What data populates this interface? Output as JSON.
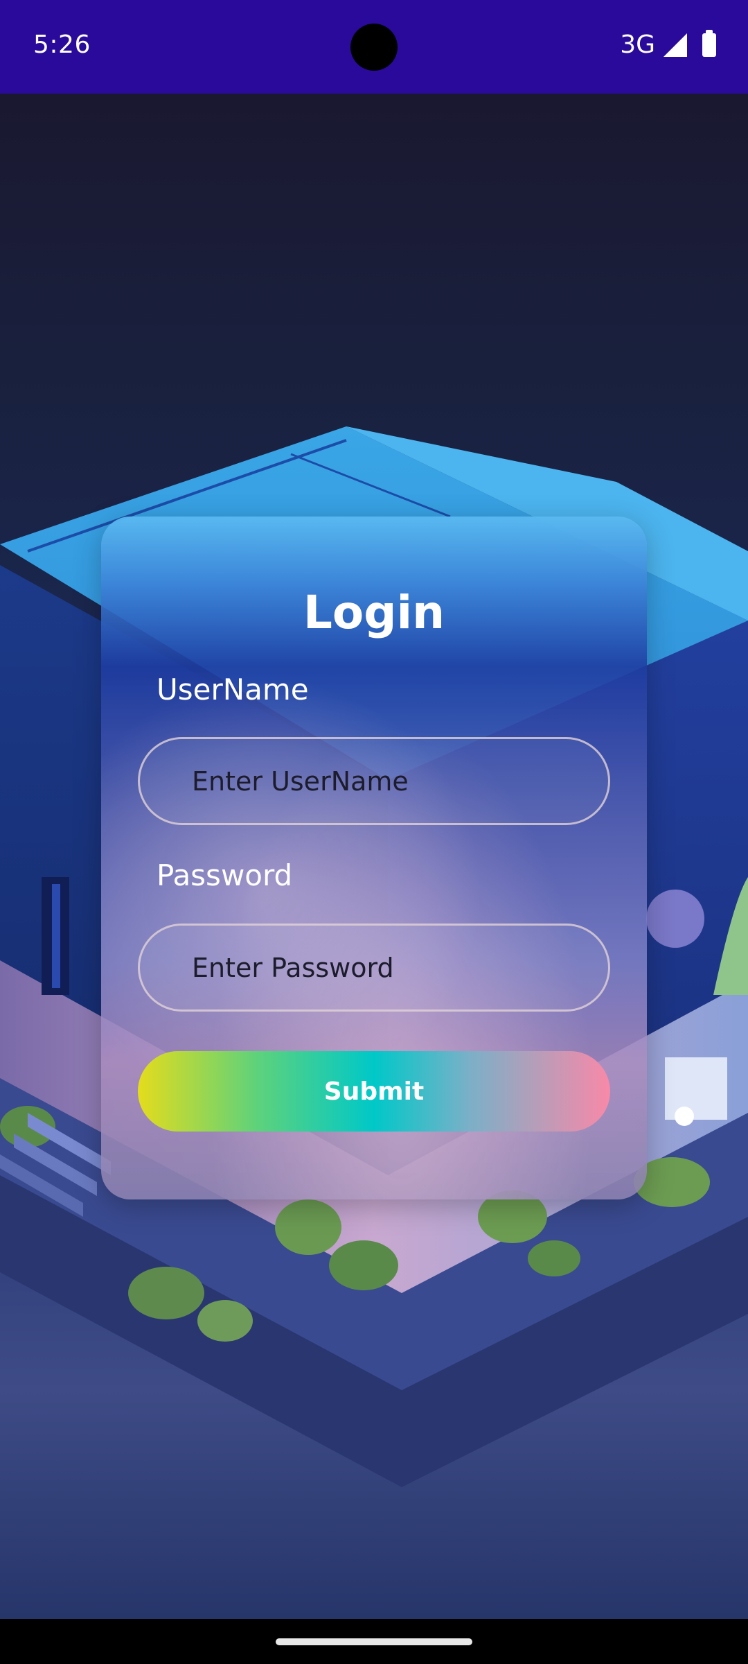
{
  "status_bar": {
    "time": "5:26",
    "network": "3G",
    "icons": [
      "signal-icon",
      "battery-icon"
    ],
    "background_color": "#2a0a9a"
  },
  "login": {
    "title": "Login",
    "username_label": "UserName",
    "username_placeholder": "Enter UserName",
    "password_label": "Password",
    "password_placeholder": "Enter Password",
    "submit_label": "Submit"
  },
  "colors": {
    "submit_gradient": [
      "#e4dc1c",
      "#5fd27a",
      "#00c8c8",
      "#f889a8"
    ]
  }
}
